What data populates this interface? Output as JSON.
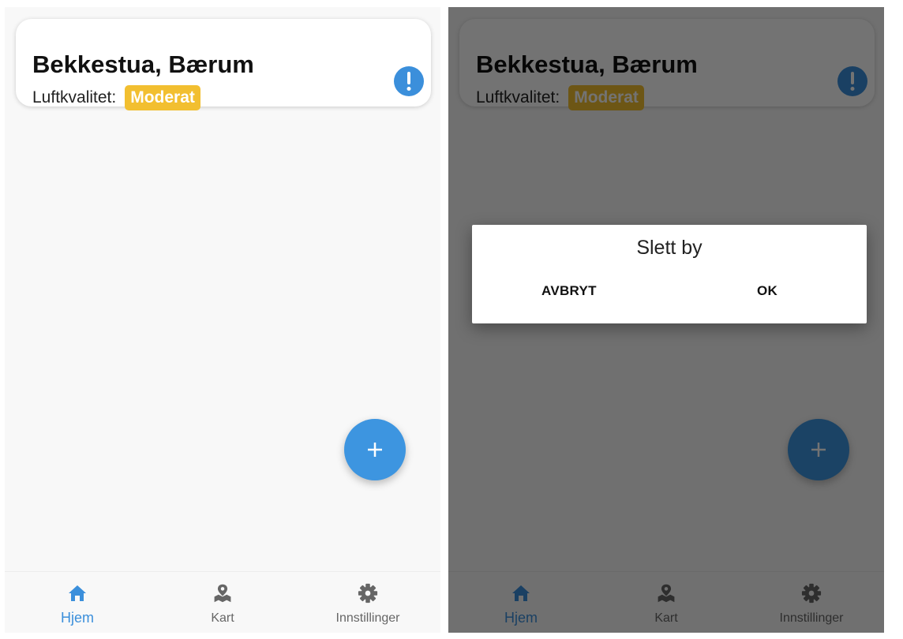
{
  "city_card": {
    "name": "Bekkestua, Bærum",
    "aq_label": "Luftkvalitet:",
    "aq_value": "Moderat",
    "aq_color": "#f2bf30",
    "info_icon": "exclamation-icon"
  },
  "fab": {
    "icon": "plus-icon",
    "color": "#3d95e0"
  },
  "nav": {
    "items": [
      {
        "label": "Hjem",
        "icon": "home-icon",
        "active": true
      },
      {
        "label": "Kart",
        "icon": "map-pin-icon",
        "active": false
      },
      {
        "label": "Innstillinger",
        "icon": "gear-icon",
        "active": false
      }
    ],
    "active_color": "#3b8fdb"
  },
  "dialog": {
    "title": "Slett by",
    "cancel_label": "AVBRYT",
    "ok_label": "OK"
  }
}
